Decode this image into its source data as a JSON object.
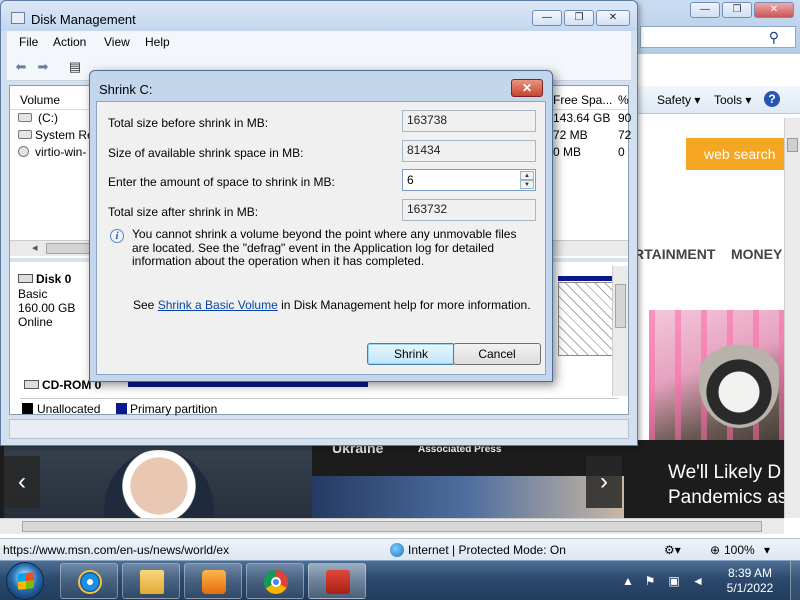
{
  "ie": {
    "cmd_safety": "Safety",
    "cmd_tools": "Tools",
    "web_search": "web search",
    "nav_entertainment": "RTAINMENT",
    "nav_money": "MONEY",
    "headline_right": "We'll Likely D\nPandemics as",
    "headline_mid_top": "Ukraine",
    "headline_mid_source": "Associated Press",
    "status_url": "https://www.msn.com/en-us/news/world/ex",
    "status_zone": "Internet | Protected Mode: On",
    "status_zoom": "100%"
  },
  "dm": {
    "title": "Disk Management",
    "menu": [
      "File",
      "Action",
      "View",
      "Help"
    ],
    "columns": {
      "volume": "Volume",
      "free_space": "Free Spa...",
      "pct": "%"
    },
    "rows": [
      {
        "volume": "(C:)",
        "free": "143.64 GB",
        "pct": "90"
      },
      {
        "volume": "System Re",
        "free": "72 MB",
        "pct": "72"
      },
      {
        "volume": "virtio-win-",
        "free": "0 MB",
        "pct": "0"
      }
    ],
    "disk0": {
      "name": "Disk 0",
      "type": "Basic",
      "size": "160.00 GB",
      "status": "Online"
    },
    "cdrom": "CD-ROM 0",
    "legend": {
      "unallocated": "Unallocated",
      "primary": "Primary partition",
      "unallocated_color": "#000000",
      "primary_color": "#0a1a8c"
    }
  },
  "shrink": {
    "title": "Shrink C:",
    "total_before_label": "Total size before shrink in MB:",
    "total_before_value": "163738",
    "available_label": "Size of available shrink space in MB:",
    "available_value": "81434",
    "amount_label": "Enter the amount of space to shrink in MB:",
    "amount_value": "6",
    "total_after_label": "Total size after shrink in MB:",
    "total_after_value": "163732",
    "info_text": "You cannot shrink a volume beyond the point where any unmovable files are located. See the \"defrag\" event in the Application log for detailed information about the operation when it has completed.",
    "see_prefix": "See ",
    "see_link": "Shrink a Basic Volume",
    "see_suffix": " in Disk Management help for more information.",
    "shrink_button": "Shrink",
    "cancel_button": "Cancel"
  },
  "taskbar": {
    "time": "8:39 AM",
    "date": "5/1/2022"
  }
}
